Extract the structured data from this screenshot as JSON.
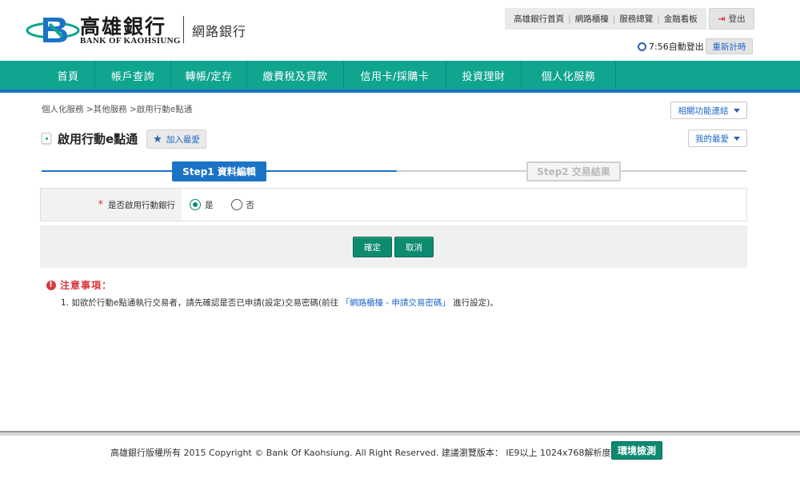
{
  "brand": {
    "name_cn": "高雄銀行",
    "name_en": "BANK OF KAOHSIUNG",
    "subtitle": "網路銀行"
  },
  "toplinks": [
    "高雄銀行首頁",
    "網路櫃檯",
    "服務總覽",
    "金融看板"
  ],
  "logout_label": "登出",
  "timer": {
    "text": "7:56自動登出",
    "reset_label": "重新計時"
  },
  "nav": {
    "items": [
      {
        "label": "首頁"
      },
      {
        "label": "帳戶查詢"
      },
      {
        "label": "轉帳/定存"
      },
      {
        "label": "繳費稅及貸款"
      },
      {
        "label": "信用卡/採購卡"
      },
      {
        "label": "投資理財"
      },
      {
        "label": "個人化服務"
      }
    ]
  },
  "breadcrumb": "個人化服務 >其他服務 >啟用行動e點通",
  "related_label": "相關功能連結",
  "page_title": "啟用行動e點通",
  "add_fav_label": "加入最愛",
  "my_fav_label": "我的最愛",
  "steps": {
    "step1": "Step1 資料編輯",
    "step2": "Step2 交易結果"
  },
  "form": {
    "label": "是否啟用行動銀行",
    "required_mark": "*",
    "options": [
      "是",
      "否"
    ],
    "selected": "是"
  },
  "buttons": {
    "confirm": "確定",
    "cancel": "取消"
  },
  "notes": {
    "title": "注意事項：",
    "line_prefix": "1. 如欲於行動e點通執行交易者，請先確認是否已申請(設定)交易密碼(前往",
    "line_link": "「網路櫃檯 - 申請交易密碼」",
    "line_suffix": "進行設定)。"
  },
  "footer": {
    "text": "高雄銀行版權所有 2015 Copyright © Bank Of Kaohsiung. All Right Reserved. 建議瀏覽版本： IE9以上 1024x768解析度為佳",
    "env_check_label": "環境檢測"
  },
  "colors": {
    "nav": "#0fa58e",
    "accent_blue": "#1a73c6",
    "button_green": "#0d8a70",
    "alert_red": "#d9363e"
  }
}
